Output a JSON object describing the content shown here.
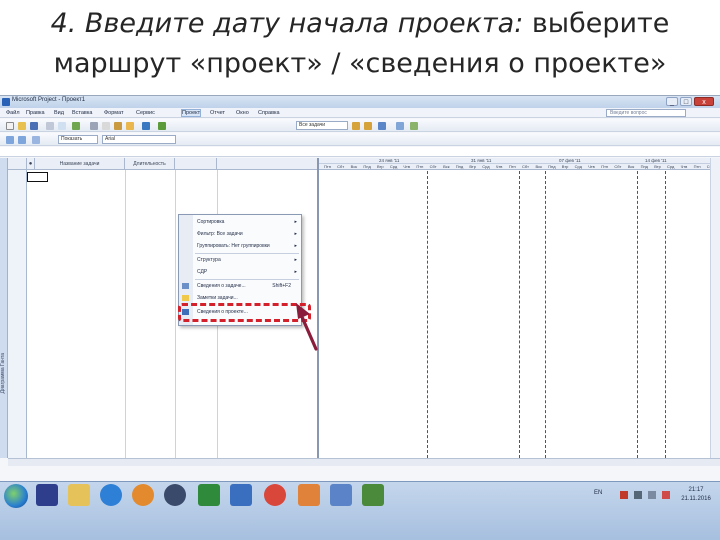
{
  "slide": {
    "title_italic": "4. Введите дату начала проекта:",
    "title_rest": " выберите",
    "title_line2": "маршрут «проект» / «сведения о проекте»"
  },
  "window": {
    "title": "Microsoft Project - Проект1",
    "min": "_",
    "max": "□",
    "close": "x"
  },
  "menubar": {
    "items": [
      "Файл",
      "Правка",
      "Вид",
      "Вставка",
      "Формат",
      "Сервис",
      "Проект",
      "Отчет",
      "Окно",
      "Справка"
    ],
    "help_placeholder": "Введите вопрос"
  },
  "toolbar": {
    "grouping": "Все задачи",
    "font": "Arial",
    "show_label": "Показать"
  },
  "grid": {
    "headers": [
      "Название задачи",
      "Длительность"
    ]
  },
  "side_label": "Диаграмма Ганта",
  "gantt": {
    "weeks": [
      "24 янв '11",
      "31 янв '11",
      "07 фев '11",
      "14 фев '11"
    ],
    "days": [
      "Птн",
      "Сбт",
      "Вск",
      "Пнд",
      "Втр",
      "Срд",
      "Чтв",
      "Птн",
      "Сбт",
      "Вск",
      "Пнд",
      "Втр",
      "Срд",
      "Чтв",
      "Птн",
      "Сбт",
      "Вск",
      "Пнд",
      "Втр",
      "Срд",
      "Чтв",
      "Птн",
      "Сбт",
      "Вск",
      "Пнд",
      "Втр",
      "Срд",
      "Чтв",
      "Птн",
      "Сбт"
    ]
  },
  "menu": {
    "items": [
      {
        "label": "Сортировка",
        "arrow": "▸"
      },
      {
        "label": "Фильтр: Все задачи",
        "arrow": "▸"
      },
      {
        "label": "Группировать: Нет группировки",
        "arrow": "▸"
      },
      {
        "label": "Структура",
        "arrow": "▸"
      },
      {
        "label": "СДР",
        "arrow": "▸"
      },
      {
        "label": "Сведения о задаче...",
        "key": "Shift+F2"
      },
      {
        "label": "Заметки задачи..."
      },
      {
        "label": "Сведения о проекте..."
      }
    ]
  },
  "taskbar": {
    "lang": "EN",
    "time": "21:17",
    "date": "21.11.2016"
  },
  "colors": {
    "highlight": "#d3202a",
    "arrow": "#8b1d3c"
  }
}
